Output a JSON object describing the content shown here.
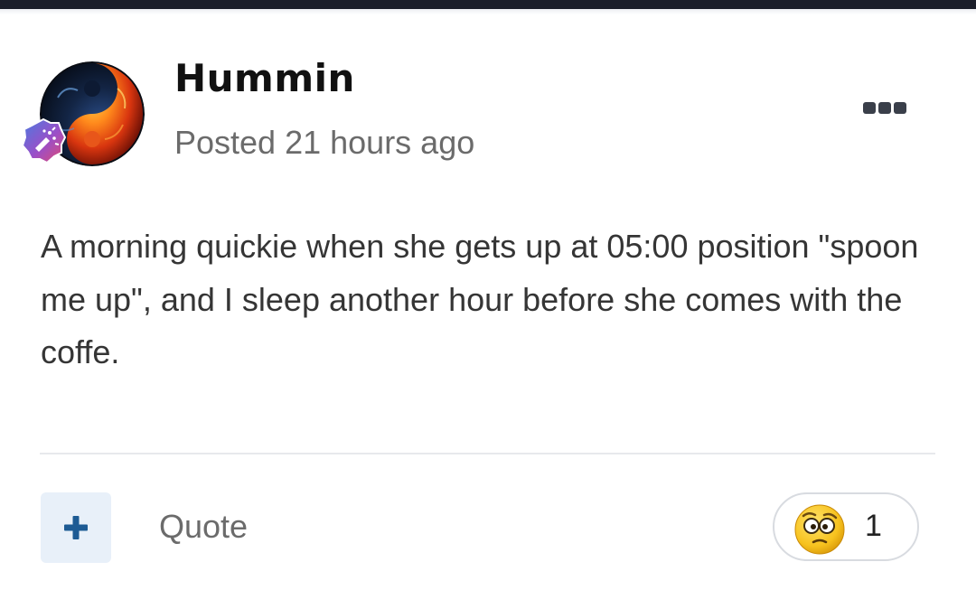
{
  "post": {
    "author": "Hummin",
    "posted": "Posted 21 hours ago",
    "body": "A morning quickie when she gets up at 05:00 position \"spoon me up\", and I sleep another hour before she comes with the coffe."
  },
  "actions": {
    "plus_label": "+",
    "quote_label": "Quote"
  },
  "reaction": {
    "icon": "confused-face-icon",
    "count": "1"
  },
  "icons": {
    "avatar": "yin-yang-fire-ice-avatar",
    "rank_badge": "confetti-rank-badge-icon",
    "more": "more-options-icon"
  },
  "colors": {
    "topbar": "#1b1e2a",
    "accent": "#1d5b94",
    "plus_bg": "#e8f0f9",
    "text_muted": "#6b6b6b"
  }
}
